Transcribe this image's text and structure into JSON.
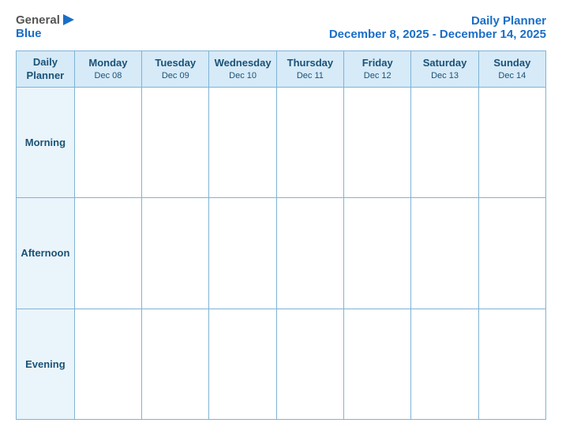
{
  "header": {
    "logo": {
      "general": "General",
      "blue": "Blue"
    },
    "title": "Daily Planner",
    "date_range": "December 8, 2025 - December 14, 2025"
  },
  "columns": [
    {
      "id": "label",
      "day": "Daily",
      "day2": "Planner",
      "date": ""
    },
    {
      "id": "mon",
      "day": "Monday",
      "date": "Dec 08"
    },
    {
      "id": "tue",
      "day": "Tuesday",
      "date": "Dec 09"
    },
    {
      "id": "wed",
      "day": "Wednesday",
      "date": "Dec 10"
    },
    {
      "id": "thu",
      "day": "Thursday",
      "date": "Dec 11"
    },
    {
      "id": "fri",
      "day": "Friday",
      "date": "Dec 12"
    },
    {
      "id": "sat",
      "day": "Saturday",
      "date": "Dec 13"
    },
    {
      "id": "sun",
      "day": "Sunday",
      "date": "Dec 14"
    }
  ],
  "rows": [
    {
      "id": "morning",
      "label": "Morning"
    },
    {
      "id": "afternoon",
      "label": "Afternoon"
    },
    {
      "id": "evening",
      "label": "Evening"
    }
  ]
}
